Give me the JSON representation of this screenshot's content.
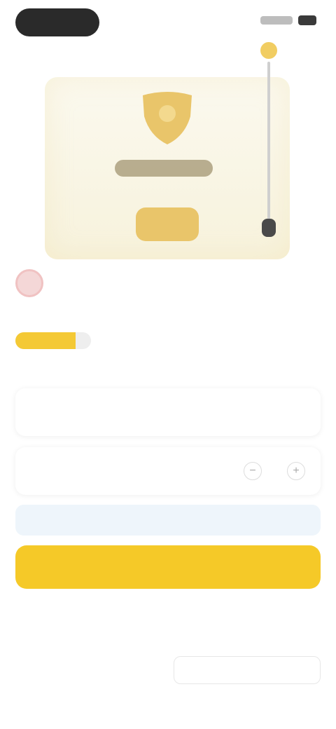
{
  "status_bar": {
    "time": "",
    "battery_icon": "battery-icon",
    "signal_icon": "signal-icon"
  },
  "hero": {
    "title": "",
    "badge": ""
  },
  "seller": {
    "name": ""
  },
  "product": {
    "name": "",
    "price": ""
  },
  "rating": {
    "value_fraction": 0.8,
    "count": ""
  },
  "options": [
    {
      "label": "",
      "value": ""
    },
    {
      "label": "",
      "quantity": ""
    }
  ],
  "note": {
    "text": ""
  },
  "cta": {
    "label": ""
  },
  "subtext": "",
  "links": {
    "left": "",
    "right": ""
  },
  "section": {
    "heading": ""
  },
  "colors": {
    "accent": "#f5c928",
    "rating": "#f4c935",
    "note_bg": "#eef5fb"
  }
}
